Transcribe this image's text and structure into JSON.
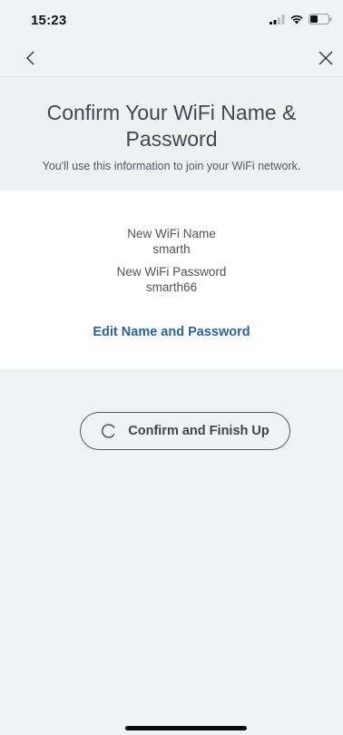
{
  "status_bar": {
    "time": "15:23",
    "icons": [
      "signal-icon",
      "wifi-icon",
      "battery-icon"
    ]
  },
  "nav": {
    "back_icon": "chevron-left-icon",
    "close_icon": "close-icon"
  },
  "header": {
    "title": "Confirm Your WiFi Name & Password",
    "subtitle": "You'll use this information to join your WiFi network."
  },
  "details": {
    "name_label": "New WiFi Name",
    "name_value": "smarth",
    "password_label": "New WiFi Password",
    "password_value": "smarth66",
    "edit_link": "Edit Name and Password"
  },
  "actions": {
    "confirm_label": "Confirm and Finish Up",
    "confirm_icon": "loading-spinner-icon"
  },
  "colors": {
    "accent_link": "#25649f",
    "background": "#f1f2f4"
  }
}
